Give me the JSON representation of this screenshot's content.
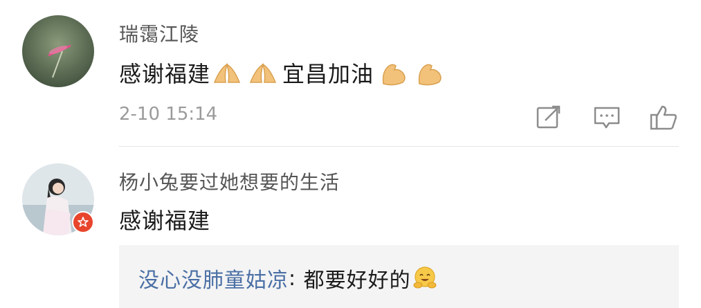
{
  "comments": [
    {
      "username": "瑞霭江陵",
      "text_part1": "感谢福建",
      "emoji1": "folded-hands-icon",
      "text_part2": "宜昌加油",
      "emoji2": "flexed-biceps-icon",
      "time": "2-10 15:14",
      "actions": [
        "share-icon",
        "comment-icon",
        "like-icon"
      ]
    },
    {
      "username": "杨小兔要过她想要的生活",
      "text": "感谢福建",
      "badge": "vip-badge-icon",
      "reply": {
        "user": "没心没肺童姑凉",
        "separator": ":",
        "text": " 都要好好的",
        "emoji": "hugging-face-icon"
      }
    }
  ],
  "colors": {
    "username": "#555555",
    "reply_user": "#4a6fa5",
    "time": "#9a9a9a",
    "badge": "#e8452c",
    "reply_bg": "#f4f4f4"
  }
}
